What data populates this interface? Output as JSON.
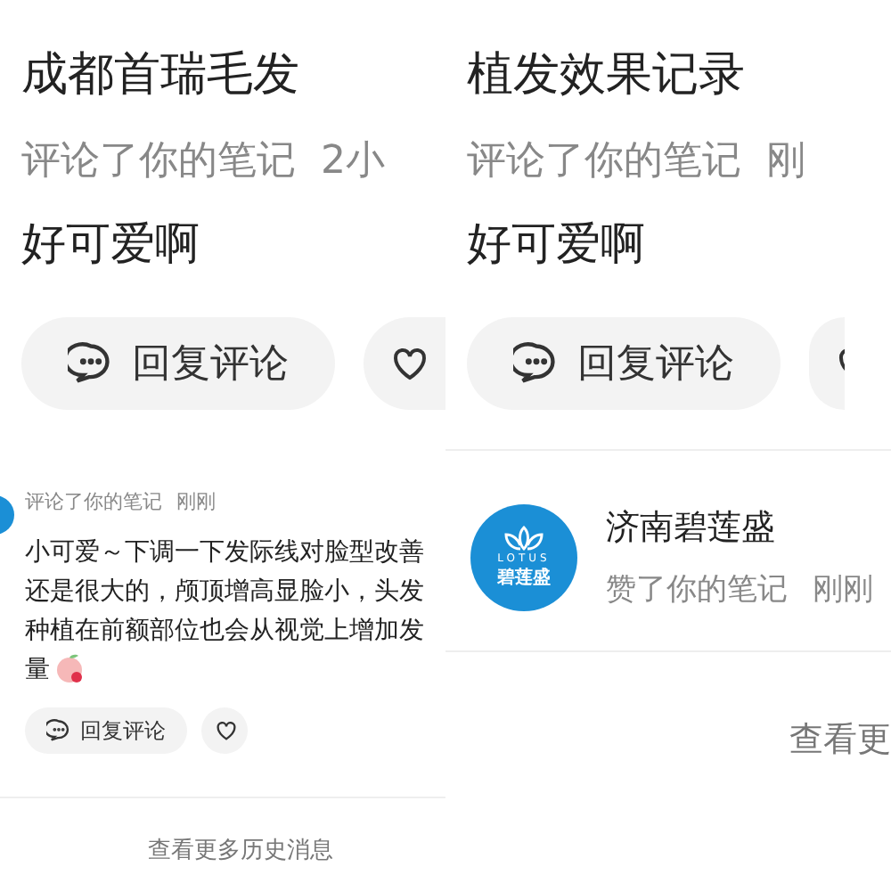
{
  "columns": [
    {
      "panels": [
        {
          "kind": "zoomed",
          "items": [
            {
              "kind": "comment",
              "author": "成都首瑞毛发",
              "action": "评论了你的笔记",
              "time": "2小",
              "comment": "好可爱啊",
              "reply_button": "回复评论"
            }
          ]
        },
        {
          "kind": "normal",
          "items": [
            {
              "kind": "comment",
              "action": "评论了你的笔记",
              "time": "刚刚",
              "comment": "小可爱～下调一下发际线对脸型改善还是很大的，颅顶增高显脸小，头发种植在前额部位也会从视觉上增加发量",
              "sticker": true,
              "reply_button": "回复评论"
            },
            {
              "kind": "more",
              "label": "查看更多历史消息"
            }
          ]
        }
      ]
    },
    {
      "panels": [
        {
          "kind": "zoomed",
          "items": [
            {
              "kind": "comment",
              "author": "植发效果记录",
              "action": "评论了你的笔记",
              "time": "刚",
              "comment": "好可爱啊",
              "reply_button": "回复评论"
            },
            {
              "kind": "like",
              "author": "济南碧莲盛",
              "avatar_text": [
                "LOTUS",
                "碧莲盛"
              ],
              "action": "赞了你的笔记",
              "time": "刚刚"
            },
            {
              "kind": "more",
              "label": "查看更"
            }
          ]
        }
      ]
    }
  ]
}
